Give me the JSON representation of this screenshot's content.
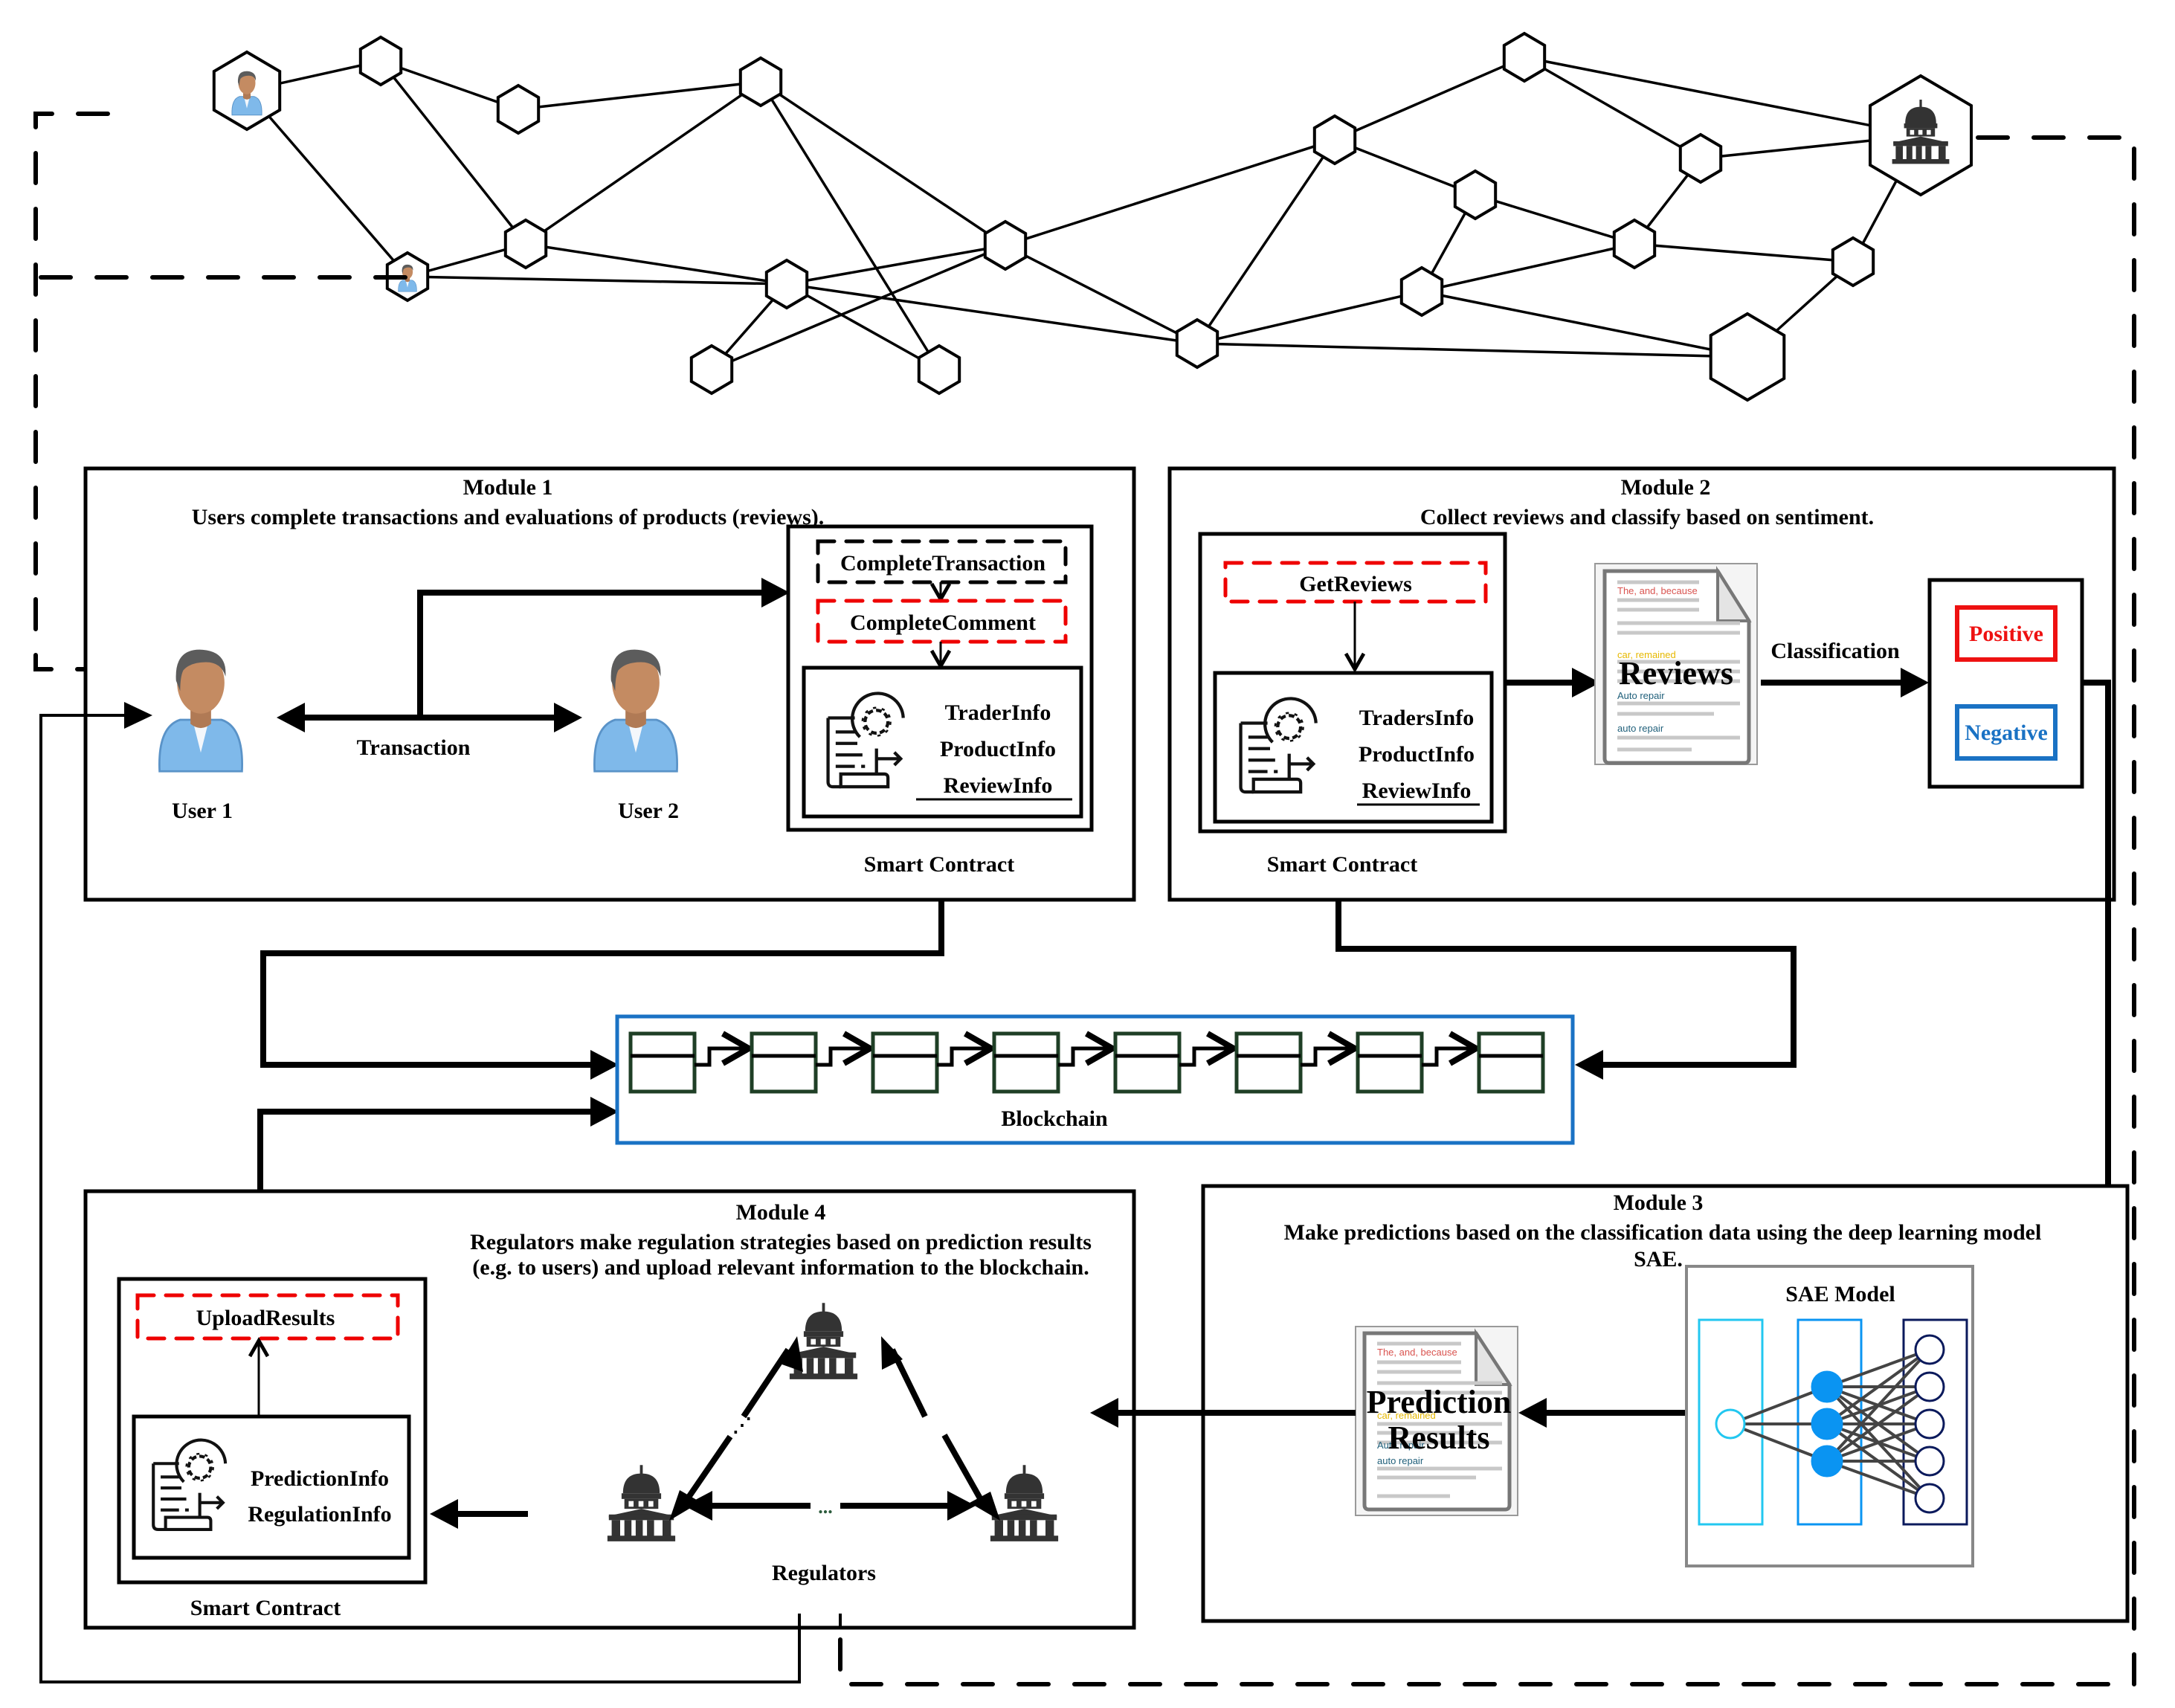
{
  "network": {
    "nodes_label": "peer-to-peer network",
    "user_node_icon": "user-icon",
    "regulator_node_icon": "government-building-icon"
  },
  "module1": {
    "title": "Module 1",
    "description": "Users complete transactions and evaluations of  products (reviews).",
    "user1_label": "User 1",
    "user2_label": "User 2",
    "transaction_label": "Transaction",
    "functions": [
      "CompleteTransaction",
      "CompleteComment"
    ],
    "info_fields": [
      "TraderInfo",
      "ProductInfo",
      "ReviewInfo"
    ],
    "contract_label": "Smart Contract"
  },
  "module2": {
    "title": "Module 2",
    "description": "Collect reviews and classify based on sentiment.",
    "function": "GetReviews",
    "info_fields": [
      "TradersInfo",
      "ProductInfo",
      "ReviewInfo"
    ],
    "contract_label": "Smart Contract",
    "document_label": "Reviews",
    "document_lines": [
      "The, and, because",
      "car, remained",
      "Auto repair",
      "auto repair"
    ],
    "classification_label": "Classification",
    "positive_label": "Positive",
    "negative_label": "Negative",
    "colors": {
      "positive": "#ee1111",
      "negative": "#1a72c4",
      "doc_red": "#d9534f",
      "doc_yellow": "#e6b800",
      "doc_teal": "#1f5f7a"
    }
  },
  "blockchain": {
    "label": "Blockchain",
    "block_count": 8,
    "border_color": "#1a72c4",
    "block_color": "#1f3f26"
  },
  "module3": {
    "title": "Module 3",
    "description_line1": "Make predictions based on the classification data using the deep learning model",
    "description_line2": "SAE.",
    "model_label": "SAE Model",
    "document_label_line1": "Prediction",
    "document_label_line2": "Results",
    "document_lines": [
      "The, and, because",
      "car, remained",
      "Auto repair",
      "auto repair"
    ],
    "layers": [
      {
        "name": "input",
        "nodes": 1,
        "color": "#22c7f0",
        "filled": false
      },
      {
        "name": "hidden",
        "nodes": 3,
        "color": "#0a94f2",
        "filled": true
      },
      {
        "name": "output",
        "nodes": 5,
        "color": "#0b1a5c",
        "filled": false
      }
    ]
  },
  "module4": {
    "title": "Module 4",
    "description_line1": "Regulators make regulation strategies based on prediction results",
    "description_line2": "(e.g. to users) and upload relevant information to the blockchain.",
    "function": "UploadResults",
    "info_fields": [
      "PredictionInfo",
      "RegulationInfo"
    ],
    "contract_label": "Smart Contract",
    "regulators_label": "Regulators",
    "ellipsis": "..."
  }
}
